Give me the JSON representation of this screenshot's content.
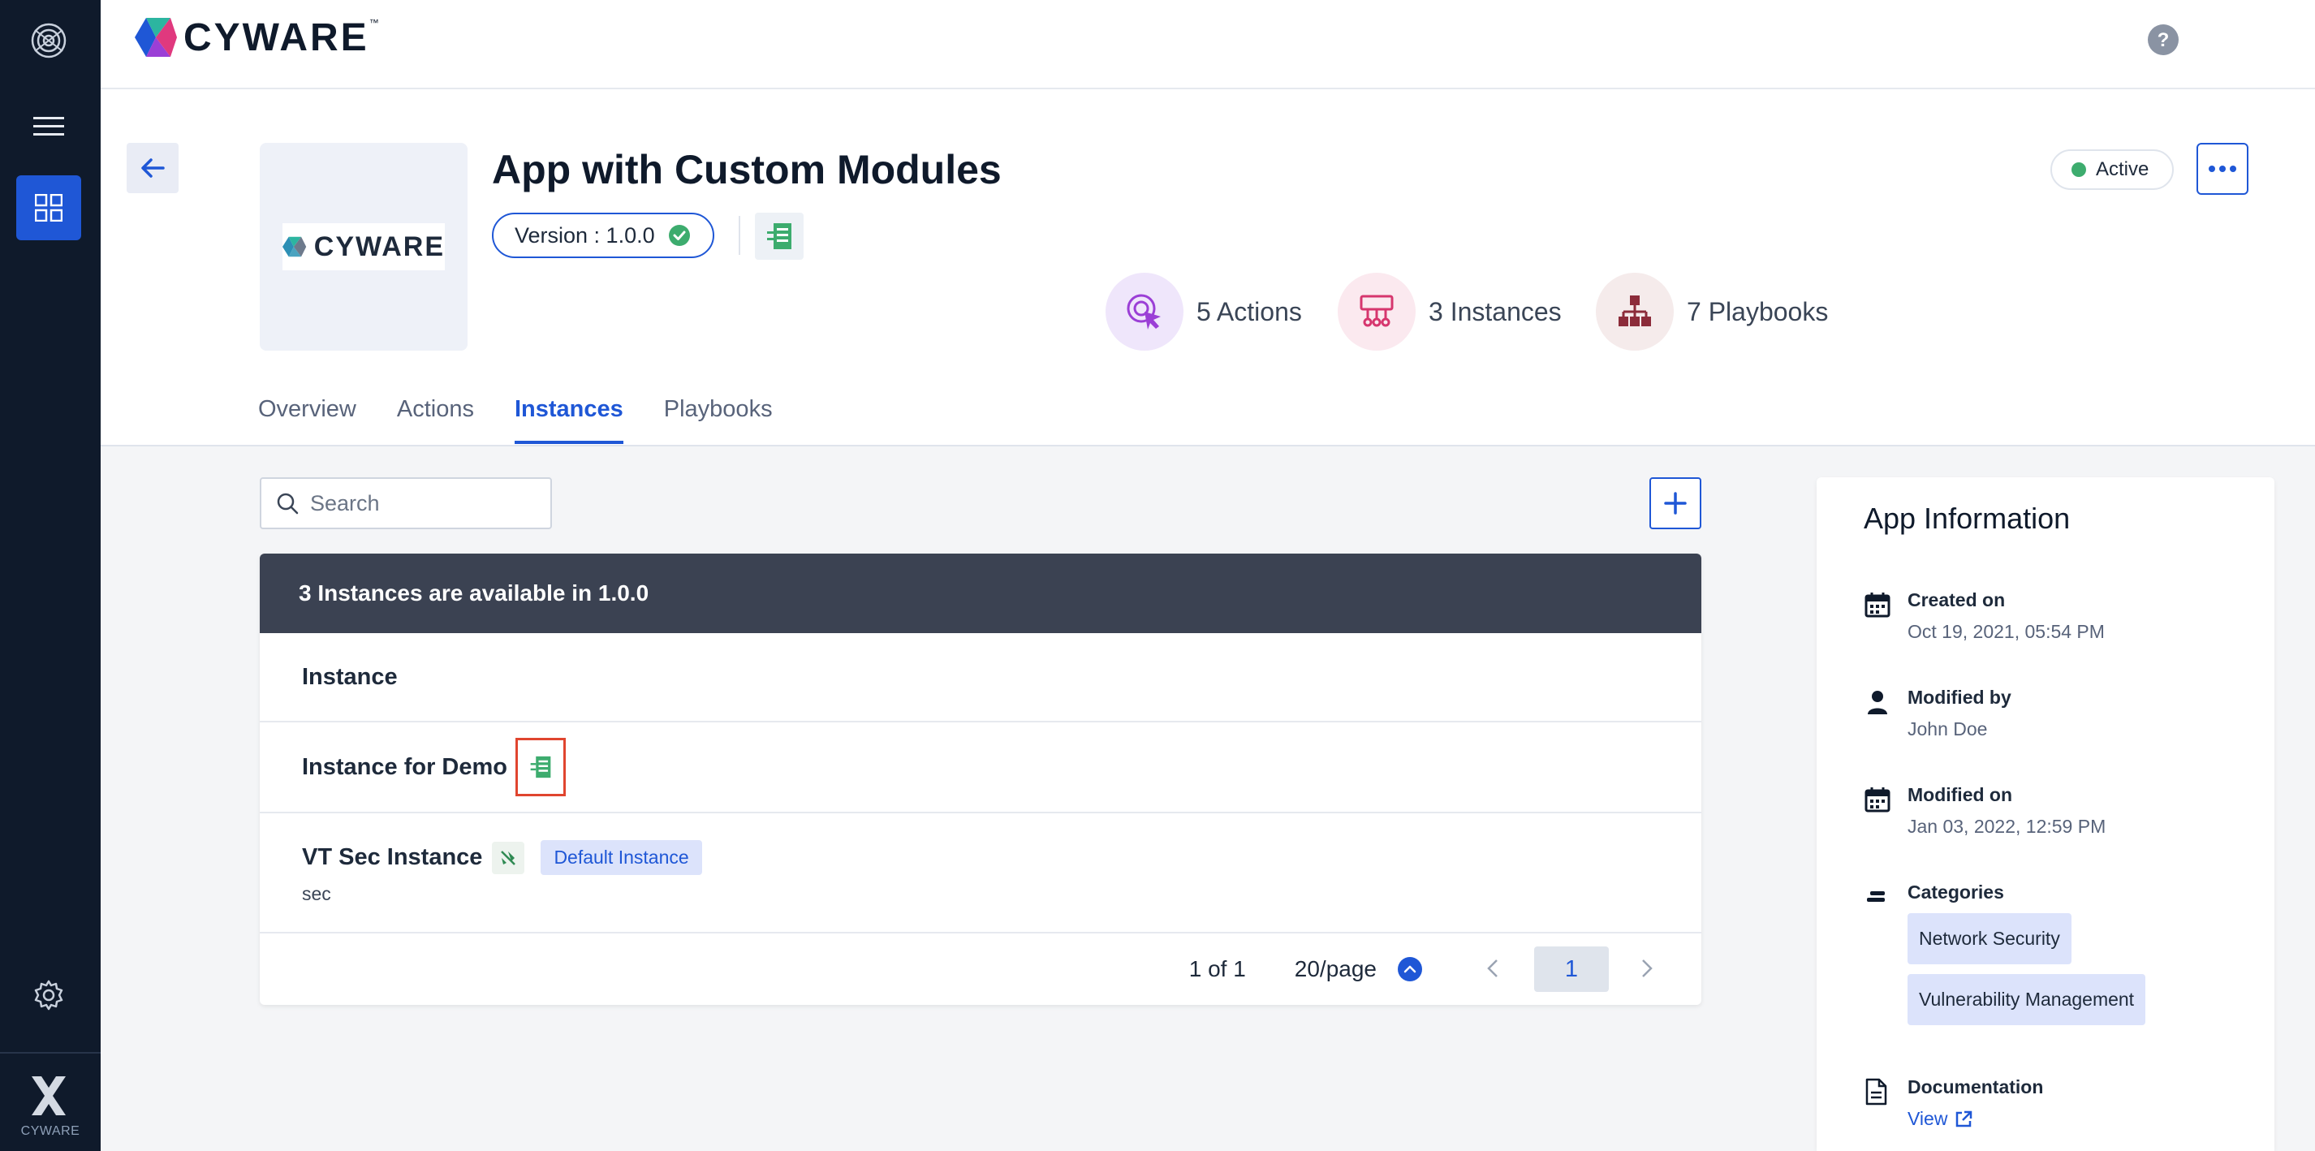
{
  "rail": {
    "brand_label": "CYWARE",
    "icons": [
      "radar-logo-icon",
      "menu-icon",
      "apps-grid-icon",
      "settings-gear-icon",
      "cyware-mark-icon"
    ]
  },
  "topbar": {
    "logo_text": "CYWARE",
    "logo_tm": "™"
  },
  "app": {
    "title": "App with Custom Modules",
    "logo_text": "CYWARE",
    "version_label": "Version : 1.0.0",
    "status": "Active"
  },
  "stats": {
    "actions": "5 Actions",
    "instances": "3 Instances",
    "playbooks": "7 Playbooks"
  },
  "tabs": [
    {
      "label": "Overview",
      "active": false
    },
    {
      "label": "Actions",
      "active": false
    },
    {
      "label": "Instances",
      "active": true
    },
    {
      "label": "Playbooks",
      "active": false
    }
  ],
  "search": {
    "placeholder": "Search"
  },
  "table": {
    "banner": "3 Instances are available in 1.0.0",
    "column_header": "Instance",
    "rows": [
      {
        "name": "Instance for Demo"
      },
      {
        "name": "VT Sec Instance",
        "badge": "Default Instance",
        "sub": "sec"
      }
    ],
    "pagination": {
      "count": "1 of 1",
      "per_page": "20/page",
      "current_page": "1"
    }
  },
  "info": {
    "title": "App Information",
    "created_label": "Created on",
    "created_value": "Oct 19, 2021, 05:54 PM",
    "modified_by_label": "Modified by",
    "modified_by_value": "John Doe",
    "modified_on_label": "Modified on",
    "modified_on_value": "Jan 03, 2022, 12:59 PM",
    "categories_label": "Categories",
    "categories": [
      "Network Security",
      "Vulnerability Management"
    ],
    "documentation_label": "Documentation",
    "documentation_link": "View"
  },
  "colors": {
    "accent": "#1f57d6",
    "rail_bg": "#0f1a2b",
    "status_active": "#3dac6e",
    "highlight_box": "#e0452f"
  }
}
